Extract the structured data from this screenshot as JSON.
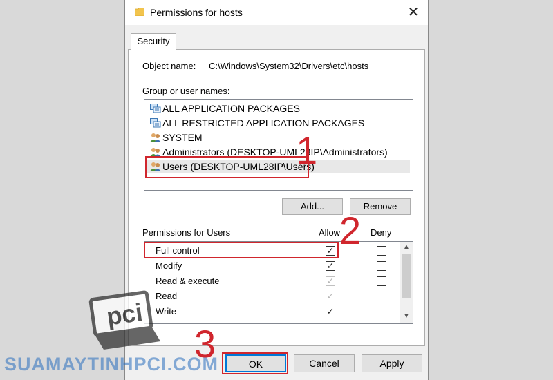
{
  "window": {
    "title": "Permissions for hosts",
    "close_symbol": "✕"
  },
  "tabs": [
    {
      "label": "Security"
    }
  ],
  "object": {
    "label": "Object name:",
    "value": "C:\\Windows\\System32\\Drivers\\etc\\hosts"
  },
  "groups": {
    "label": "Group or user names:",
    "items": [
      {
        "name": "ALL APPLICATION PACKAGES",
        "icon": "package-group-icon"
      },
      {
        "name": "ALL RESTRICTED APPLICATION PACKAGES",
        "icon": "package-group-icon"
      },
      {
        "name": "SYSTEM",
        "icon": "users-icon"
      },
      {
        "name": "Administrators (DESKTOP-UML28IP\\Administrators)",
        "icon": "users-icon"
      },
      {
        "name": "Users (DESKTOP-UML28IP\\Users)",
        "icon": "users-icon",
        "selected": true
      }
    ],
    "add_label": "Add...",
    "remove_label": "Remove"
  },
  "permissions": {
    "header": "Permissions for Users",
    "allow_label": "Allow",
    "deny_label": "Deny",
    "rows": [
      {
        "name": "Full control",
        "allow": "checked",
        "deny": "unchecked"
      },
      {
        "name": "Modify",
        "allow": "checked",
        "deny": "unchecked"
      },
      {
        "name": "Read & execute",
        "allow": "inherited",
        "deny": "unchecked"
      },
      {
        "name": "Read",
        "allow": "inherited",
        "deny": "unchecked"
      },
      {
        "name": "Write",
        "allow": "checked",
        "deny": "unchecked"
      }
    ]
  },
  "footer": {
    "ok_label": "OK",
    "cancel_label": "Cancel",
    "apply_label": "Apply"
  },
  "annotations": {
    "step1": "1",
    "step2": "2",
    "step3": "3",
    "color": "#d0262d"
  },
  "watermark": {
    "text": "SUAMAYTINHPCI.COM",
    "logo_text": "pci"
  },
  "colors": {
    "accent": "#0078d7",
    "dialog_bg": "#f0f0f0"
  }
}
